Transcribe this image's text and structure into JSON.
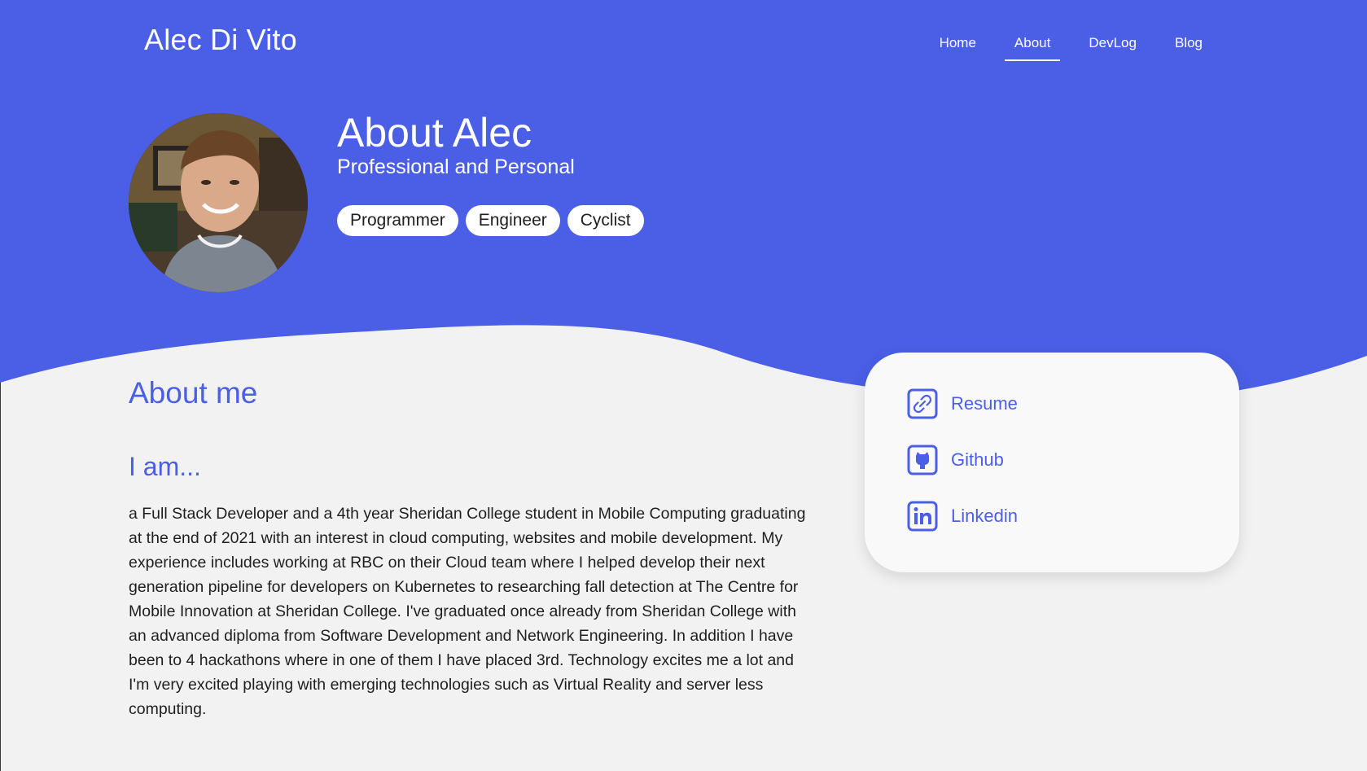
{
  "colors": {
    "brand_blue": "#4a5fe6",
    "hero_text": "#ffffff",
    "page_bg": "#f2f2f3",
    "card_bg": "#f9f9fa"
  },
  "header": {
    "brand": "Alec Di Vito",
    "nav": [
      {
        "label": "Home",
        "active": false
      },
      {
        "label": "About",
        "active": true
      },
      {
        "label": "DevLog",
        "active": false
      },
      {
        "label": "Blog",
        "active": false
      }
    ]
  },
  "hero": {
    "title": "About Alec",
    "subtitle": "Professional and Personal",
    "tags": [
      "Programmer",
      "Engineer",
      "Cyclist"
    ]
  },
  "about": {
    "heading": "About me",
    "subheading": "I am...",
    "bio": "a Full Stack Developer and a 4th year Sheridan College student in Mobile Computing graduating at the end of 2021 with an interest in cloud computing, websites and mobile development. My experience includes working at RBC on their Cloud team where I helped develop their next generation pipeline for developers on Kubernetes to researching fall detection at The Centre for Mobile Innovation at Sheridan College. I've graduated once already from Sheridan College with an advanced diploma from Software Development and Network Engineering. In addition I have been to 4 hackathons where in one of them I have placed 3rd. Technology excites me a lot and I'm very excited playing with emerging technologies such as Virtual Reality and server less computing."
  },
  "links": [
    {
      "label": "Resume",
      "icon": "link-icon"
    },
    {
      "label": "Github",
      "icon": "github-icon"
    },
    {
      "label": "Linkedin",
      "icon": "linkedin-icon"
    }
  ]
}
